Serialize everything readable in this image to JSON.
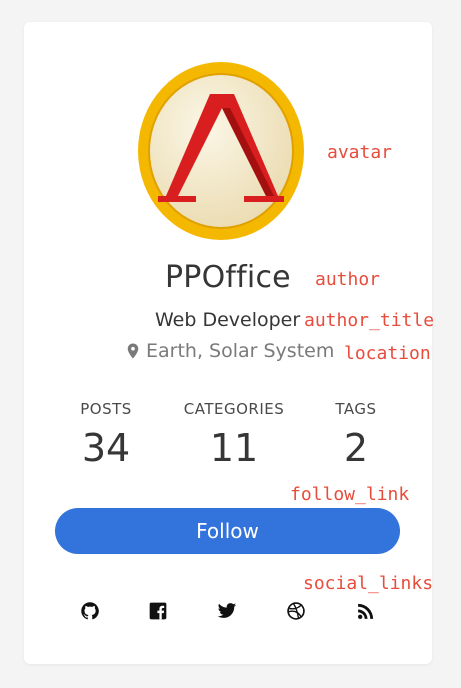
{
  "profile": {
    "author": "PPOffice",
    "author_title": "Web Developer",
    "location": "Earth, Solar System"
  },
  "stats": [
    {
      "heading": "POSTS",
      "value": "34"
    },
    {
      "heading": "CATEGORIES",
      "value": "11"
    },
    {
      "heading": "TAGS",
      "value": "2"
    }
  ],
  "follow": {
    "label": "Follow"
  },
  "social_links": [
    {
      "icon": "github-icon"
    },
    {
      "icon": "facebook-icon"
    },
    {
      "icon": "twitter-icon"
    },
    {
      "icon": "dribbble-icon"
    },
    {
      "icon": "rss-icon"
    }
  ],
  "annotations": {
    "avatar": "avatar",
    "author": "author",
    "author_title": "author_title",
    "location": "location",
    "follow_link": "follow_link",
    "social_links": "social_links"
  },
  "colors": {
    "accent": "#3273dc",
    "annotation": "#e74c3c",
    "avatar_ring": "#f5b800",
    "avatar_logo": "#d81e1e"
  }
}
